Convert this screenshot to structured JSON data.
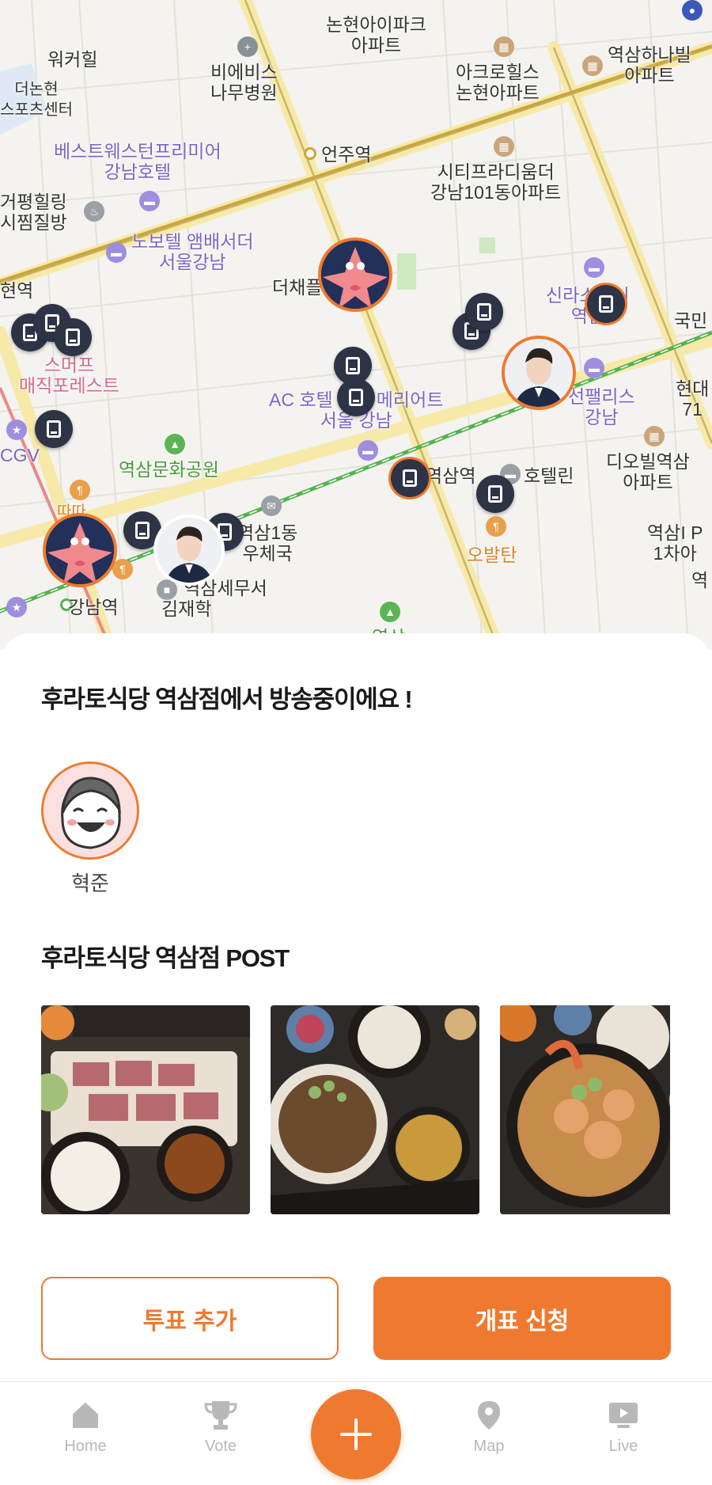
{
  "colors": {
    "accent": "#ef7a2f",
    "pin": "#2d3446",
    "tab_inactive": "#b8b8b8",
    "hotel_label": "#7b64c4",
    "park_label": "#4a9a3a",
    "food_label": "#d8842a"
  },
  "map": {
    "labels": {
      "nonhyeon_ipark": "논현아이파크\n아파트",
      "woocheol": "워커힐",
      "the_nonhyeon": "더논현\n스포츠센터",
      "bieobiseu": "비에비스\n나무병원",
      "acro": "아크로힐스\n논현아파트",
      "yeoksam_hanavil": "역삼하나빌\n아파트",
      "best_western": "베스트웨스턴프리미어\n강남호텔",
      "eonju_station": "언주역",
      "city_paradium": "시티프라디움더\n강남101동아파트",
      "geopyeong": "거평힐링\n시찜질방",
      "novotel": "노보텔 앰배서더\n서울강남",
      "hyeon_station": "현역",
      "dechae": "더채플",
      "shilla": "신라스테이\n역삼",
      "kookmin": "국민",
      "smuff": "스머프\n매직포레스트",
      "ac_hotel": "AC 호텔 바이 메리어트\n서울 강남",
      "sunpalace": "선팰리스\n강남",
      "hyundai": "현대\n71",
      "cgv": "CGV",
      "yeoksam_park": "역삼문화공원",
      "yeoksam_station": "역삼역",
      "hotelrin": "호텔린",
      "diovil": "디오빌역삼\n아파트",
      "ttaradda": "따따",
      "yeoksam1_post": "역삼1동\n우체국",
      "obaltan": "오발탄",
      "yeoksam_ipark": "역삼I P\n1차아",
      "yeoksam_tax": "역삼세무서",
      "gangnam_station": "강남역",
      "kimjaehak": "김재학",
      "yeok": "역",
      "yeoksan": "역삼"
    }
  },
  "sheet": {
    "broadcast_title": "후라토식당 역삼점에서 방송중이에요 !",
    "host_name": "혁준",
    "post_title": "후라토식당 역삼점 POST",
    "buttons": {
      "vote_add": "투표 추가",
      "count_apply": "개표 신청"
    }
  },
  "tabbar": {
    "home": "Home",
    "vote": "Vote",
    "map": "Map",
    "live": "Live",
    "fab_icon": "plus-icon"
  }
}
